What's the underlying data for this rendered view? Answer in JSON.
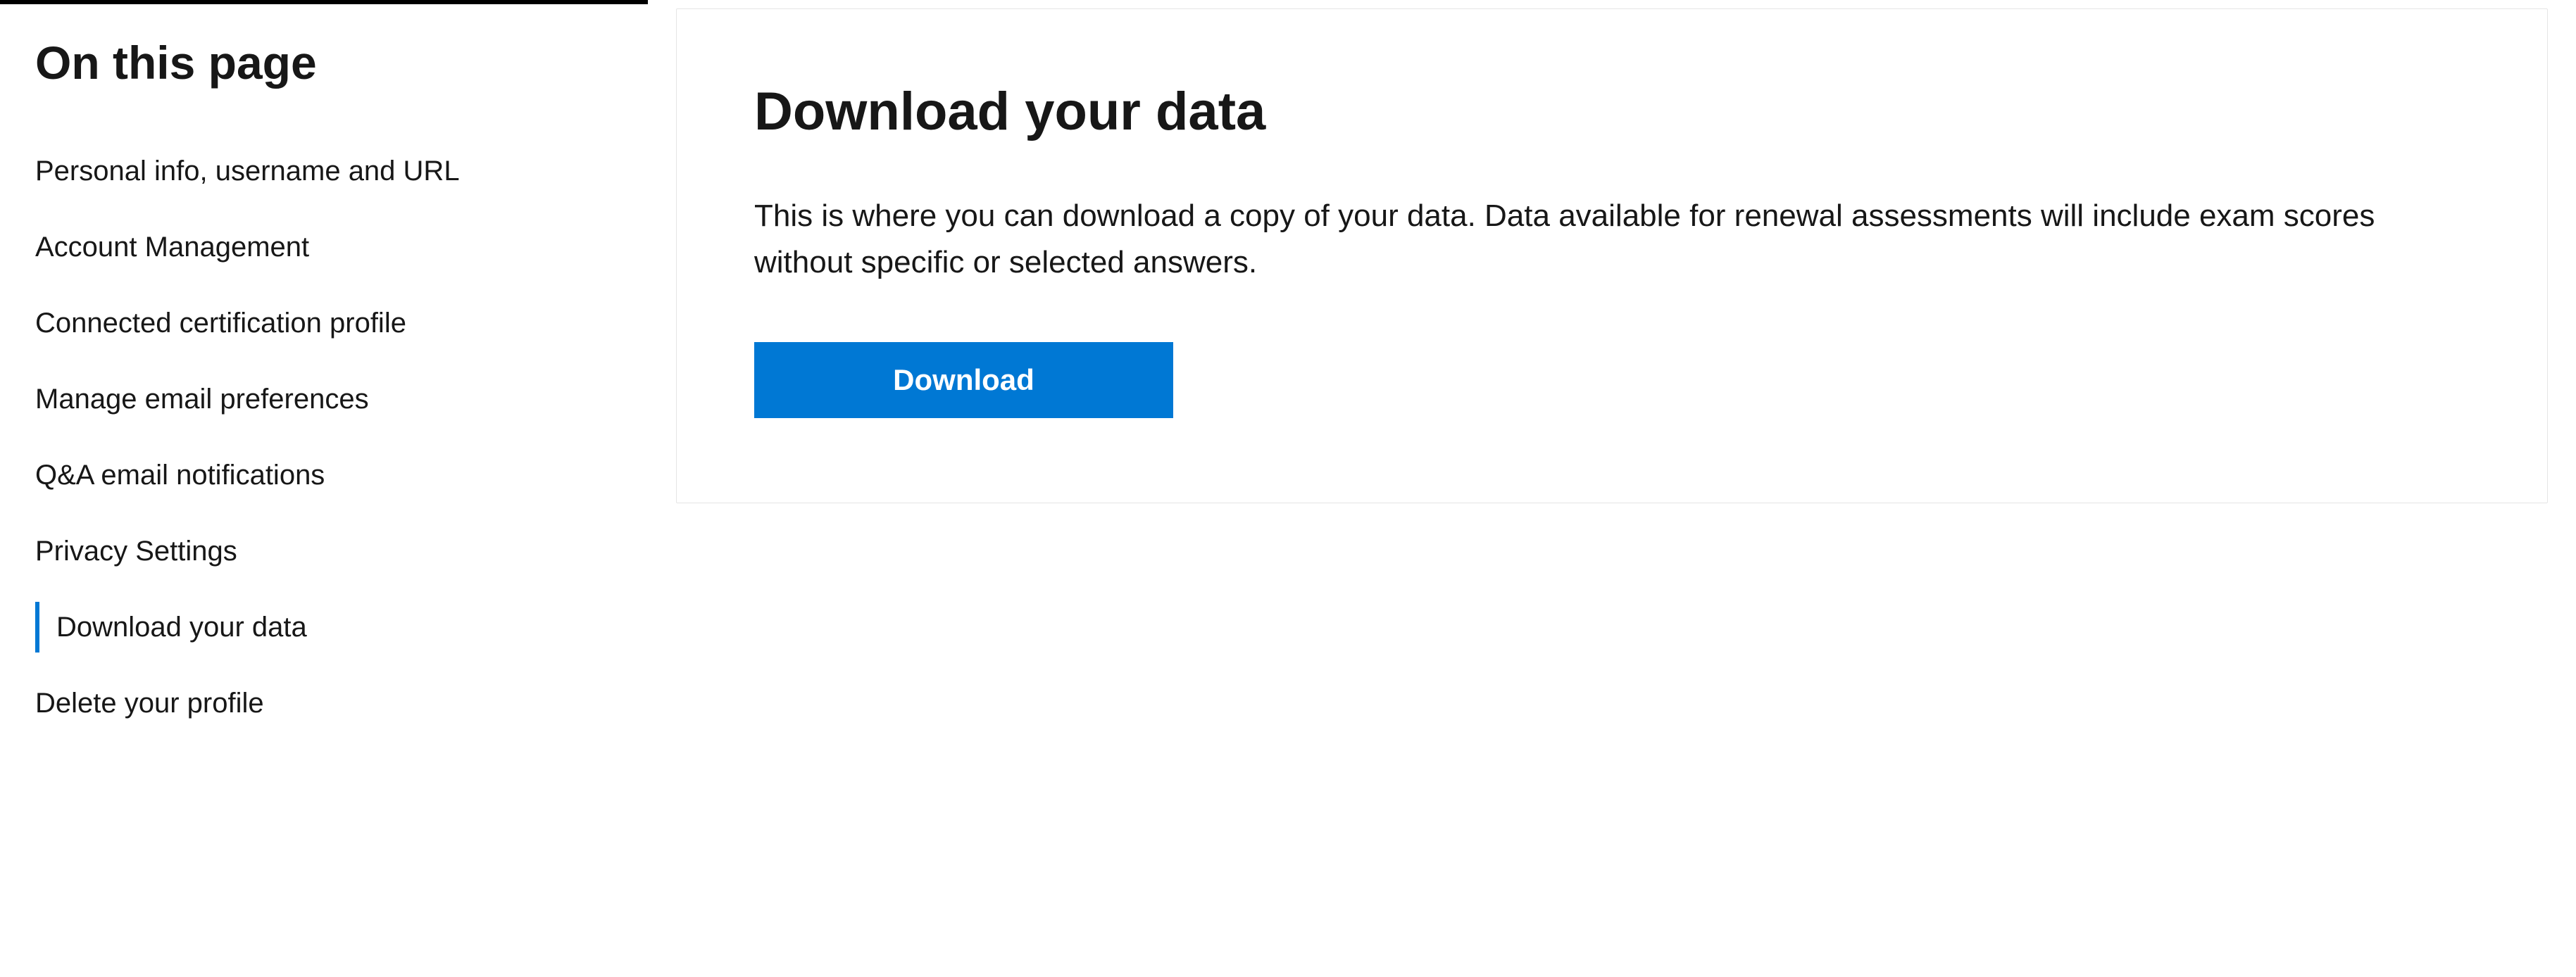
{
  "sidebar": {
    "heading": "On this page",
    "items": [
      {
        "label": "Personal info, username and URL",
        "active": false
      },
      {
        "label": "Account Management",
        "active": false
      },
      {
        "label": "Connected certification profile",
        "active": false
      },
      {
        "label": "Manage email preferences",
        "active": false
      },
      {
        "label": "Q&A email notifications",
        "active": false
      },
      {
        "label": "Privacy Settings",
        "active": false
      },
      {
        "label": "Download your data",
        "active": true
      },
      {
        "label": "Delete your profile",
        "active": false
      }
    ]
  },
  "main": {
    "title": "Download your data",
    "description": "This is where you can download a copy of your data. Data available for renewal assessments will include exam scores without specific or selected answers.",
    "download_label": "Download"
  }
}
